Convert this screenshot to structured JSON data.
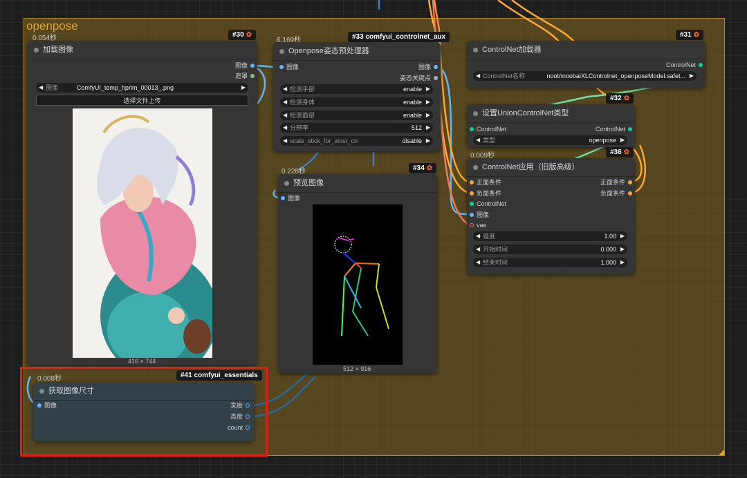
{
  "group": {
    "title": "openpose"
  },
  "nodes": {
    "load_image": {
      "id": "#30",
      "time": "0.054秒",
      "title": "加载图像",
      "outputs": [
        "图像",
        "遮罩"
      ],
      "widget": {
        "label": "图像",
        "value": "ComfyUI_temp_hprim_00013_.png"
      },
      "upload_label": "选择文件上传",
      "size": "416 × 744"
    },
    "openpose": {
      "id": "#33 comfyui_controlnet_aux",
      "time": "6.169秒",
      "title": "Openpose姿态预处理器",
      "input": "图像",
      "outputs": [
        "图像",
        "姿态关键点"
      ],
      "widgets": [
        {
          "label": "检测手部",
          "value": "enable"
        },
        {
          "label": "检测身体",
          "value": "enable"
        },
        {
          "label": "检测面部",
          "value": "enable"
        },
        {
          "label": "分辨率",
          "value": "512"
        },
        {
          "label": "scale_stick_for_xinsr_cn",
          "value": "disable"
        }
      ]
    },
    "preview": {
      "id": "#34",
      "time": "0.228秒",
      "title": "预览图像",
      "input": "图像",
      "size": "512 × 916"
    },
    "cn_loader": {
      "id": "#31",
      "title": "ControlNet加载器",
      "output": "ControlNet",
      "widget": {
        "label": "ControlNet名称",
        "value": "noob\\noobaiXLControlnet_openposeModel.safet..."
      }
    },
    "union_type": {
      "id": "#32",
      "title": "设置UnionControlNet类型",
      "input": "ControlNet",
      "output": "ControlNet",
      "widget": {
        "label": "类型",
        "value": "openpose"
      }
    },
    "cn_apply": {
      "id": "#36",
      "time": "0.009秒",
      "title": "ControlNet应用（旧版高级）",
      "inputs": [
        "正面条件",
        "负面条件",
        "ControlNet",
        "图像",
        "vae"
      ],
      "outputs": [
        "正面条件",
        "负面条件"
      ],
      "widgets": [
        {
          "label": "强度",
          "value": "1.00"
        },
        {
          "label": "开始时间",
          "value": "0.000"
        },
        {
          "label": "结束时间",
          "value": "1.000"
        }
      ]
    },
    "get_size": {
      "id": "#41 comfyui_essentials",
      "time": "0.008秒",
      "title": "获取图像尺寸",
      "input": "图像",
      "outputs": [
        "宽度",
        "高度",
        "count"
      ]
    }
  },
  "icons": {
    "badge": "fox-icon",
    "arrow_left": "triangle-left-icon",
    "arrow_right": "triangle-right-icon"
  },
  "colors": {
    "group_bg": "#846820",
    "group_title": "#e3a52a",
    "image_slot": "#64b5f6",
    "mask_slot": "#81c784",
    "controlnet_slot": "#00d78d",
    "conditioning_slot": "#ffa931",
    "vae_slot": "#ff6e6e",
    "int_slot": "#29699c",
    "highlight": "#e51d1d"
  }
}
